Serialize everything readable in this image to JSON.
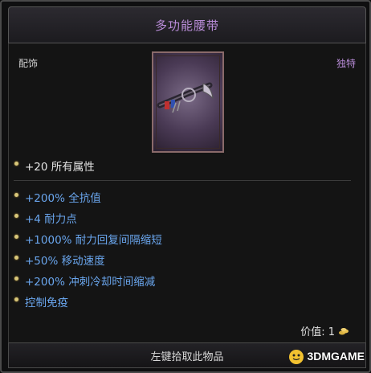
{
  "tooltip": {
    "title": "多功能腰带",
    "item_type": "配饰",
    "rarity": "独特",
    "rarity_color": "#b98cd8",
    "icon": "belt-icon"
  },
  "main_stat": {
    "text": "+20 所有属性"
  },
  "affixes": [
    {
      "text": "+200% 全抗值"
    },
    {
      "text": "+4 耐力点"
    },
    {
      "text": "+1000% 耐力回复间隔缩短"
    },
    {
      "text": "+50% 移动速度"
    },
    {
      "text": "+200% 冲刺冷却时间缩减"
    },
    {
      "text": "控制免疫"
    }
  ],
  "affix_color": "#6aa6ee",
  "price": {
    "label": "价值: 1",
    "icon": "gold-coin-icon"
  },
  "footer": {
    "action": "左键拾取此物品"
  },
  "watermark": {
    "text": "3DMGAME"
  }
}
